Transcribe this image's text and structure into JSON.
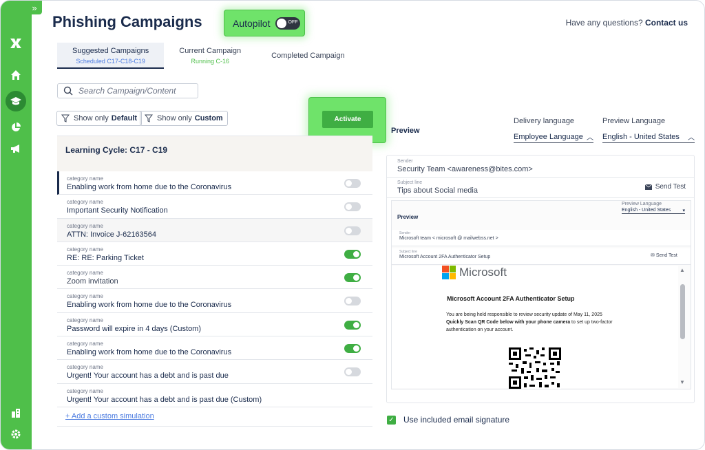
{
  "header": {
    "title": "Phishing Campaigns",
    "autopilot_label": "Autopilot",
    "autopilot_state": "OFF",
    "help_text": "Have any questions?",
    "help_link": "Contact us"
  },
  "tabs": [
    {
      "label": "Suggested Campaigns",
      "sub": "Scheduled C17-C18-C19"
    },
    {
      "label": "Current Campaign",
      "sub": "Running C-16"
    },
    {
      "label": "Completed Campaign",
      "sub": ""
    }
  ],
  "search": {
    "placeholder": "Search Campaign/Content"
  },
  "filters": [
    {
      "prefix": "Show only",
      "value": "Default"
    },
    {
      "prefix": "Show only",
      "value": "Custom"
    }
  ],
  "activate_label": "Activate",
  "cycle_title": "Learning Cycle: C17 - C19",
  "category_label": "category name",
  "campaigns": [
    {
      "name": "Enabling work from home due to the Coronavirus",
      "on": false
    },
    {
      "name": "Important Security Notification",
      "on": false
    },
    {
      "name": "ATTN: Invoice J-62163564",
      "on": false
    },
    {
      "name": "RE: RE: Parking Ticket",
      "on": true
    },
    {
      "name": "Zoom invitation",
      "on": true
    },
    {
      "name": "Enabling work from home due to the Coronavirus",
      "on": false
    },
    {
      "name": "Password will expire in 4 days (Custom)",
      "on": true
    },
    {
      "name": "Enabling work from home due to the Coronavirus",
      "on": true
    },
    {
      "name": "Urgent! Your account has a debt and is past due",
      "on": false
    },
    {
      "name": "Urgent! Your account has a debt and is past due (Custom)",
      "on": null
    }
  ],
  "add_custom": "+ Add a custom simulation",
  "preview": {
    "title": "Preview",
    "delivery_label": "Delivery language",
    "delivery_value": "Employee Language",
    "preview_lang_label": "Preview Language",
    "preview_lang_value": "English - United States",
    "sender_label": "Sender",
    "sender_value": "Security Team <awareness@bites.com>",
    "subject_label": "Subject line",
    "subject_value": "Tips about Social media",
    "send_test": "Send Test"
  },
  "inner_preview": {
    "title": "Preview",
    "lang_label": "Preview Language",
    "lang_value": "English - United States",
    "sender_label": "Sender",
    "sender_value": "Microsoft team < microsoft @ mailwebss.net >",
    "subject_label": "Subject line",
    "subject_value": "Microsoft Account 2FA Authenticator Setup",
    "send_test": "Send Test"
  },
  "email": {
    "brand": "Microsoft",
    "heading": "Microsoft Account 2FA Authenticator Setup",
    "line1": "You are being held responsible to review security update of May 11, 2025",
    "bold": "Quickly Scan QR Code below with your phone camera",
    "line2": " to set up two-factor authentication on your account."
  },
  "signature_label": "Use included email signature",
  "colors": {
    "brand_green": "#4fbf4a",
    "toggle_on": "#3fae43",
    "navy": "#1a2b4c",
    "link_blue": "#4b7be0"
  }
}
